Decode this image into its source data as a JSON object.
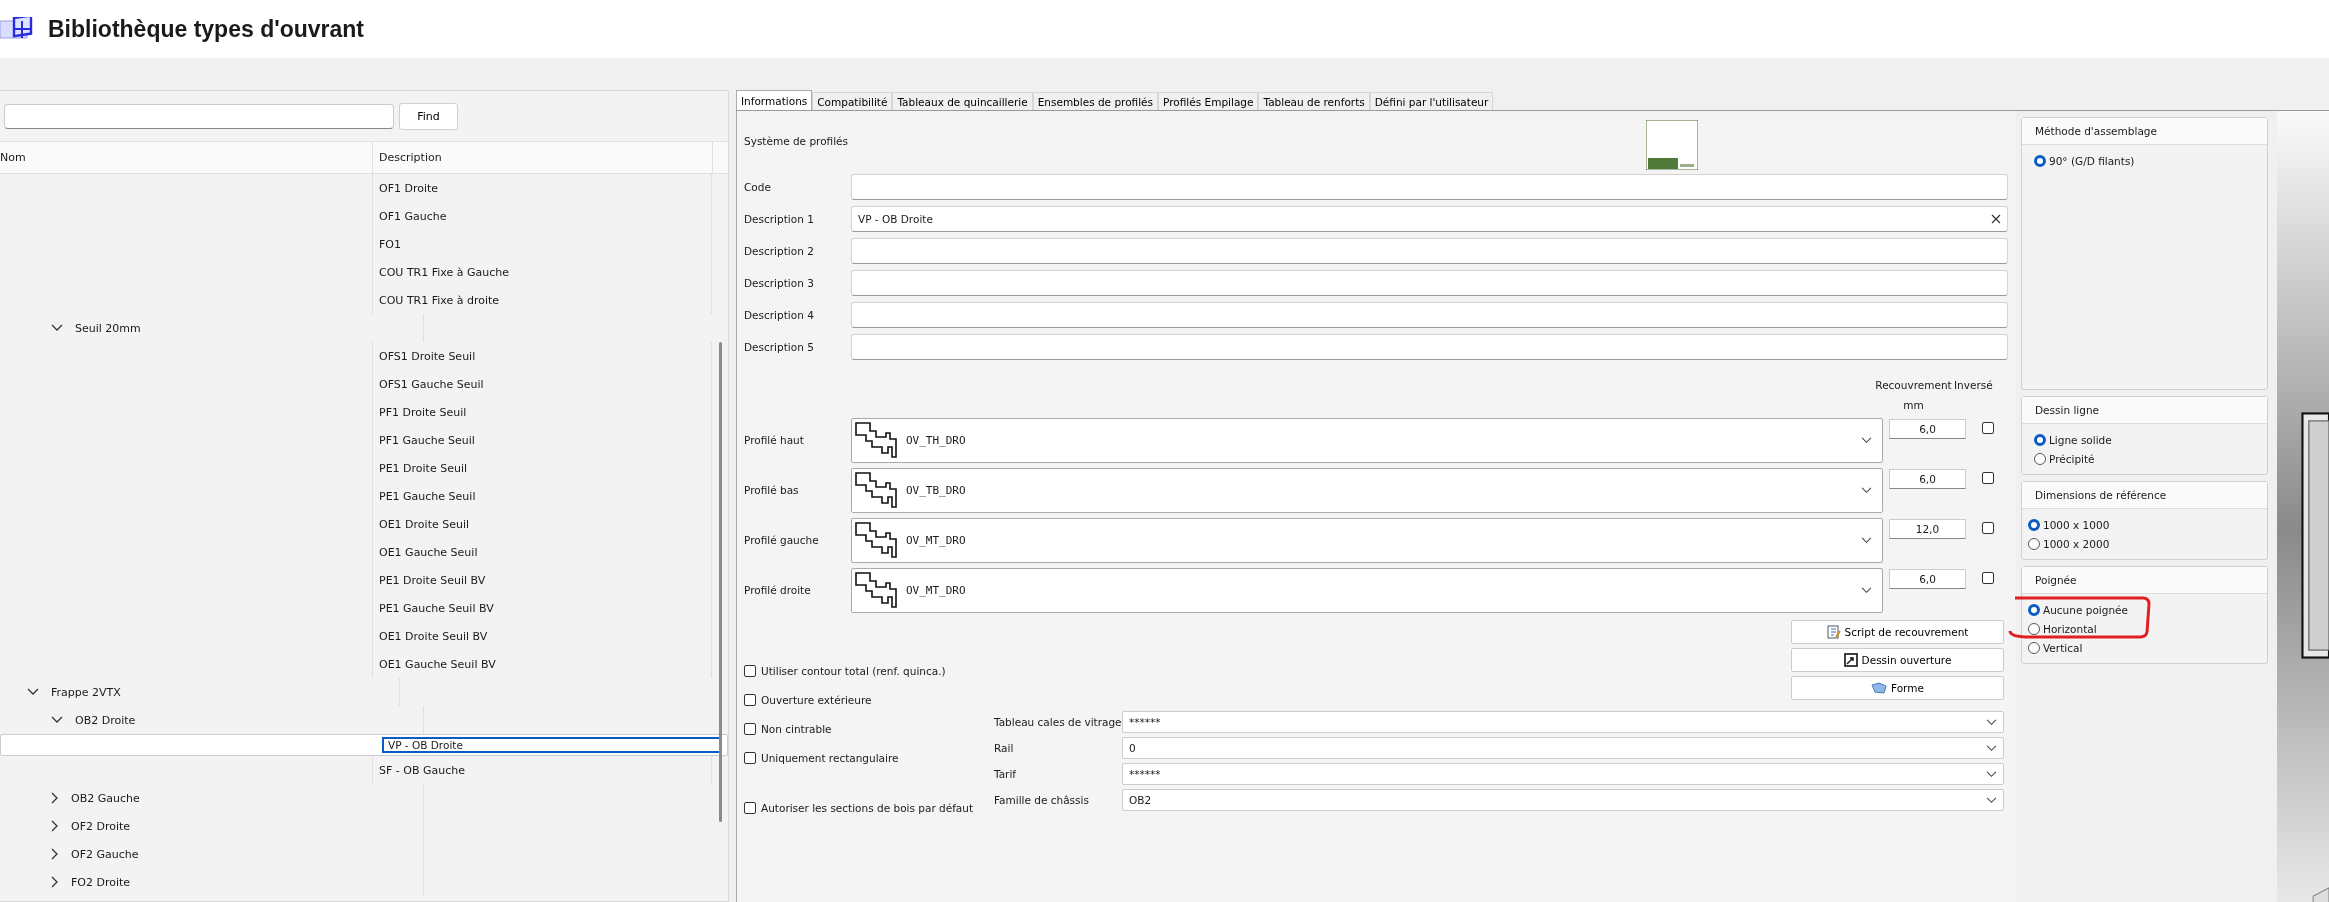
{
  "app": {
    "title": "Bibliothèque types d'ouvrant"
  },
  "search": {
    "button": "Find"
  },
  "list": {
    "columns": [
      "Nom",
      "Description"
    ],
    "tree": [
      {
        "children": [
          {
            "description": "OF1 Droite",
            "selected": false
          },
          {
            "description": "OF1 Gauche",
            "selected": false
          },
          {
            "description": "FO1",
            "selected": false
          },
          {
            "description": "COU TR1 Fixe à Gauche",
            "selected": false
          },
          {
            "description": "COU TR1 Fixe à droite",
            "selected": false
          },
          {
            "name": "Seuil 20mm",
            "expanded": true,
            "children": [
              {
                "description": "OFS1 Droite Seuil",
                "selected": false
              },
              {
                "description": "OFS1 Gauche Seuil",
                "selected": false
              },
              {
                "description": "PF1 Droite Seuil",
                "selected": false
              },
              {
                "description": "PF1 Gauche Seuil",
                "selected": false
              },
              {
                "description": "PE1 Droite Seuil",
                "selected": false
              },
              {
                "description": "PE1 Gauche Seuil",
                "selected": false
              },
              {
                "description": "OE1 Droite Seuil",
                "selected": false
              },
              {
                "description": "OE1 Gauche Seuil",
                "selected": false
              },
              {
                "description": "PE1 Droite Seuil BV",
                "selected": false
              },
              {
                "description": "PE1 Gauche Seuil BV",
                "selected": false
              },
              {
                "description": "OE1 Droite Seuil BV",
                "selected": false
              },
              {
                "description": "OE1 Gauche Seuil BV",
                "selected": false
              }
            ]
          }
        ]
      },
      {
        "name": "Frappe 2VTX",
        "expanded": true,
        "children": [
          {
            "name": "OB2 Droite",
            "expanded": true,
            "children": [
              {
                "description": "VP - OB Droite",
                "selected": true
              },
              {
                "description": "SF - OB Gauche",
                "selected": false
              }
            ]
          },
          {
            "name": "OB2 Gauche",
            "expanded": false
          },
          {
            "name": "OF2 Droite",
            "expanded": false
          },
          {
            "name": "OF2 Gauche",
            "expanded": false
          },
          {
            "name": "FO2 Droite",
            "expanded": false
          }
        ]
      }
    ]
  },
  "tabs": [
    {
      "label": "Informations",
      "selected": true
    },
    {
      "label": "Compatibilité",
      "selected": false
    },
    {
      "label": "Tableaux de quincaillerie",
      "selected": false
    },
    {
      "label": "Ensembles de profilés",
      "selected": false
    },
    {
      "label": "Profilés Empilage",
      "selected": false
    },
    {
      "label": "Tableau de renforts",
      "selected": false
    },
    {
      "label": "Défini par l'utilisateur",
      "selected": false
    }
  ],
  "form": {
    "system_label": "Système de profilés",
    "fields": [
      {
        "label": "Code"
      },
      {
        "label": "Description 1",
        "value": "VP - OB Droite",
        "clearable": true
      },
      {
        "label": "Description 2"
      },
      {
        "label": "Description 3"
      },
      {
        "label": "Description 4"
      },
      {
        "label": "Description 5"
      }
    ],
    "profile_columns": [
      "Recouvrement mm",
      "Inversé"
    ],
    "profiles": [
      {
        "label": "Profilé haut",
        "value": "OV_TH_DRO",
        "overlap": "6,0",
        "inverted": false
      },
      {
        "label": "Profilé bas",
        "value": "OV_TB_DRO",
        "overlap": "6,0",
        "inverted": false
      },
      {
        "label": "Profilé gauche",
        "value": "OV_MT_DRO",
        "overlap": "12,0",
        "inverted": false
      },
      {
        "label": "Profilé droite",
        "value": "OV_MT_DRO",
        "overlap": "6,0",
        "inverted": false
      }
    ],
    "buttons": [
      {
        "label": "Script de recouvrement",
        "kind": "script"
      },
      {
        "label": "Dessin ouverture",
        "kind": "drawing"
      },
      {
        "label": "Forme",
        "kind": "shape"
      }
    ],
    "options": [
      {
        "label": "Utiliser contour total (renf. quinca.)",
        "checked": false
      },
      {
        "label": "Ouverture extérieure",
        "checked": false
      },
      {
        "label": "Non cintrable",
        "checked": false
      },
      {
        "label": "Uniquement rectangulaire",
        "checked": false
      },
      {
        "label": "Autoriser les sections de bois par défaut",
        "checked": false
      }
    ],
    "selects": [
      {
        "label": "Tableau cales de vitrage",
        "value": "******"
      },
      {
        "label": "Rail",
        "value": "0"
      },
      {
        "label": "Tarif",
        "value": "******"
      },
      {
        "label": "Famille de châssis",
        "value": "OB2"
      }
    ]
  },
  "groups": [
    {
      "title": "Méthode d'assemblage",
      "options": [
        {
          "label": "90° (G/D filants)",
          "selected": true
        }
      ]
    },
    {
      "title": "Dessin ligne",
      "options": [
        {
          "label": "Ligne solide",
          "selected": true
        },
        {
          "label": "Précipité",
          "selected": false
        }
      ]
    },
    {
      "title": "Dimensions de référence",
      "options": [
        {
          "label": "1000 x 1000",
          "selected": true
        },
        {
          "label": "1000 x 2000",
          "selected": false
        }
      ]
    },
    {
      "title": "Poignée",
      "options": [
        {
          "label": "Aucune poignée",
          "selected": true
        },
        {
          "label": "Horizontal",
          "selected": false
        },
        {
          "label": "Vertical",
          "selected": false
        }
      ]
    }
  ]
}
